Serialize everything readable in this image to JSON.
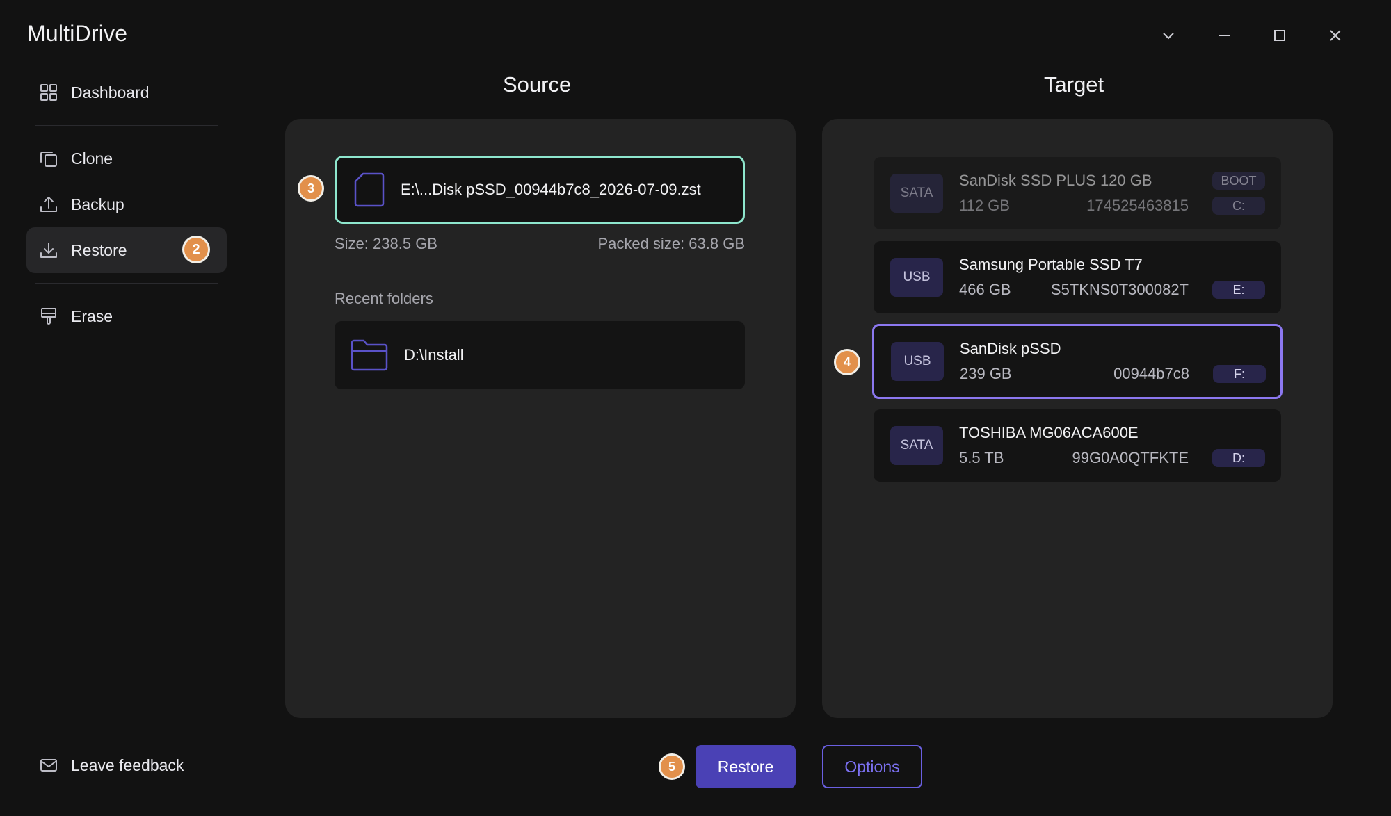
{
  "app": {
    "title": "MultiDrive"
  },
  "sidebar": {
    "items": [
      {
        "label": "Dashboard",
        "icon": "dashboard-icon"
      },
      {
        "label": "Clone",
        "icon": "clone-icon"
      },
      {
        "label": "Backup",
        "icon": "backup-icon"
      },
      {
        "label": "Restore",
        "icon": "restore-icon",
        "active": true,
        "step": "2"
      },
      {
        "label": "Erase",
        "icon": "erase-icon"
      }
    ],
    "feedback": "Leave feedback"
  },
  "source": {
    "title": "Source",
    "step": "3",
    "file": "E:\\...Disk pSSD_00944b7c8_2026-07-09.zst",
    "size": "Size: 238.5 GB",
    "packed": "Packed size: 63.8 GB",
    "recent_label": "Recent folders",
    "recent": [
      "D:\\Install"
    ]
  },
  "target": {
    "title": "Target",
    "step": "4",
    "disks": [
      {
        "type": "SATA",
        "name": "SanDisk SSD PLUS 120 GB",
        "size": "112 GB",
        "serial": "174525463815",
        "boot": "BOOT",
        "letter": "C:",
        "state": "disabled"
      },
      {
        "type": "USB",
        "name": "Samsung Portable SSD T7",
        "size": "466 GB",
        "serial": "S5TKNS0T300082T",
        "letter": "E:"
      },
      {
        "type": "USB",
        "name": "SanDisk pSSD",
        "size": "239 GB",
        "serial": "00944b7c8",
        "letter": "F:",
        "state": "selected"
      },
      {
        "type": "SATA",
        "name": "TOSHIBA MG06ACA600E",
        "size": "5.5 TB",
        "serial": "99G0A0QTFKTE",
        "letter": "D:"
      }
    ]
  },
  "actions": {
    "step": "5",
    "restore": "Restore",
    "options": "Options"
  },
  "colors": {
    "accent": "#4a41b5",
    "selected_border": "#8c78f0",
    "source_border": "#8ee6cd",
    "badge": "#e2904b"
  }
}
